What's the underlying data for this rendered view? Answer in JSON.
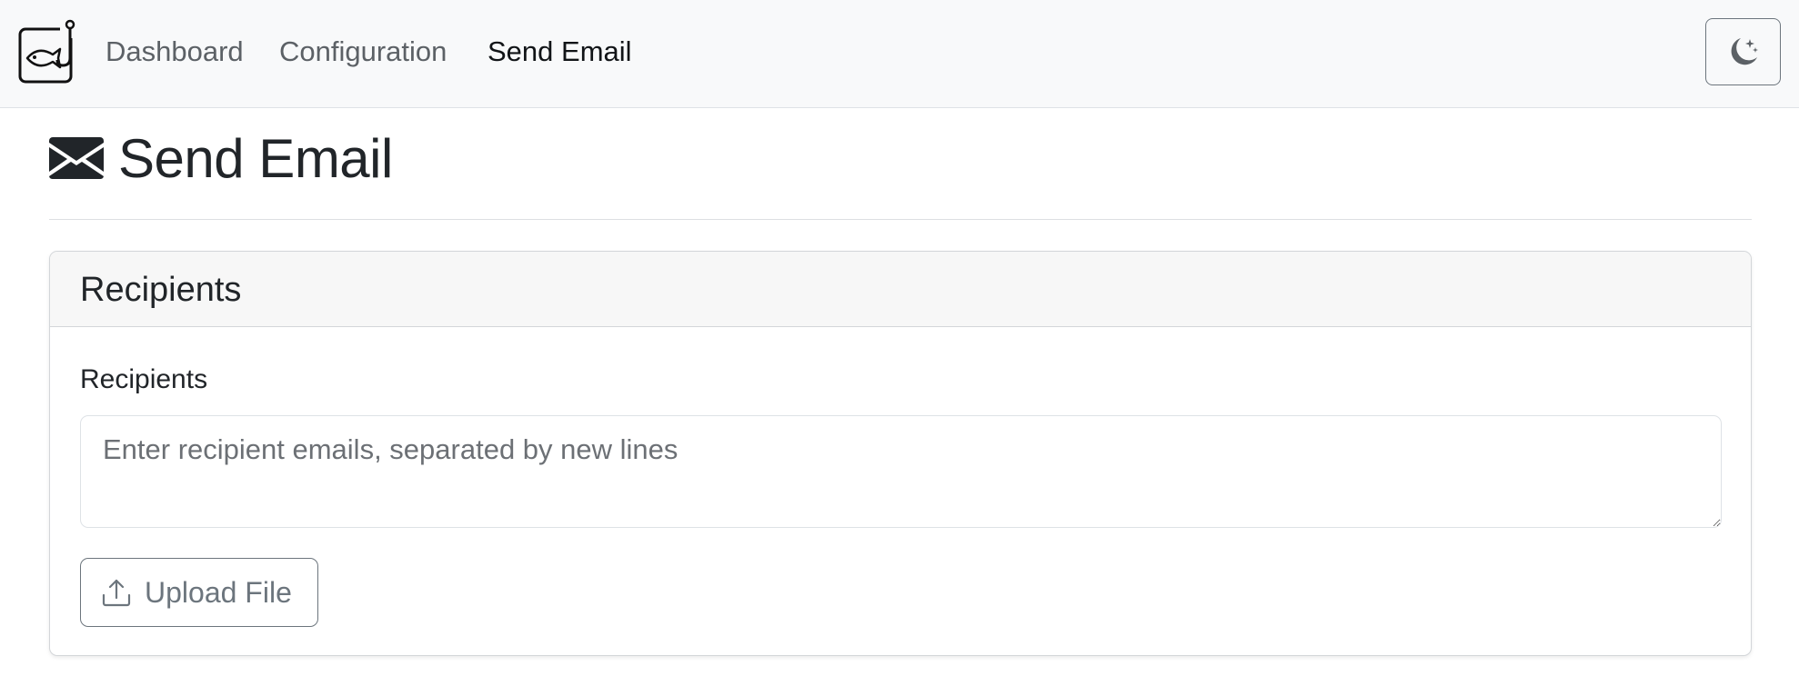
{
  "nav": {
    "brand_icon": "fish-hook-logo-icon",
    "links": [
      {
        "label": "Dashboard",
        "active": false
      },
      {
        "label": "Configuration",
        "active": false
      },
      {
        "label": "Send Email",
        "active": true
      }
    ],
    "theme_toggle_icon": "moon-stars-icon"
  },
  "page": {
    "title_icon": "envelope-icon",
    "title": "Send Email"
  },
  "card": {
    "header": "Recipients",
    "field_label": "Recipients",
    "input_value": "",
    "input_placeholder": "Enter recipient emails, separated by new lines",
    "upload_icon": "upload-icon",
    "upload_label": "Upload File"
  },
  "colors": {
    "navbar_bg": "#f8f9fa",
    "text_primary": "#212529",
    "text_muted": "#6c757d",
    "border": "#dee2e6"
  }
}
